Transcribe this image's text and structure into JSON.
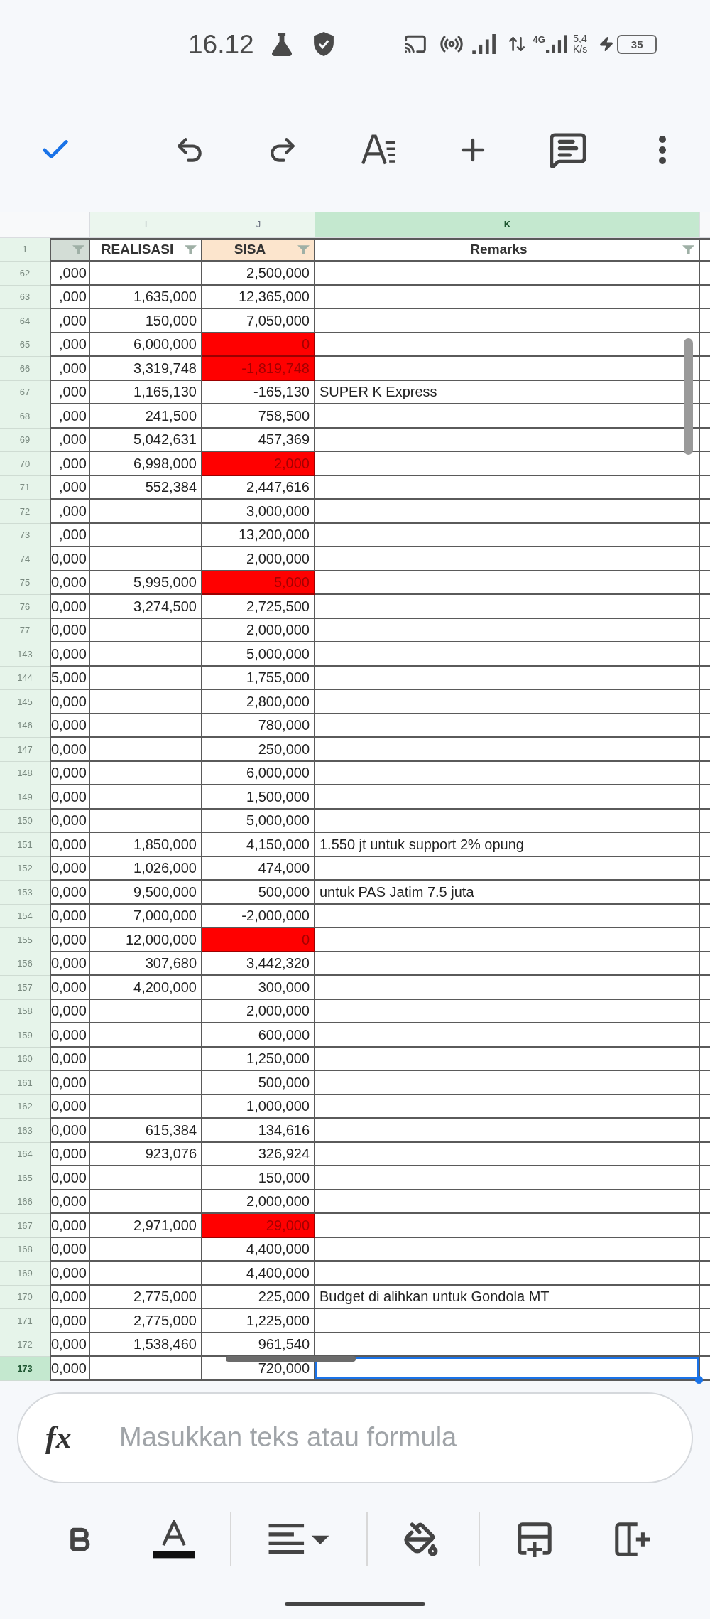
{
  "status_bar": {
    "time": "16.12",
    "network_type": "4G",
    "speed": "5,4",
    "speed_unit": "K/s",
    "battery": "35"
  },
  "sheet": {
    "columns": [
      {
        "letter": "I",
        "selected": false
      },
      {
        "letter": "J",
        "selected": false
      },
      {
        "letter": "K",
        "selected": true
      }
    ],
    "header_row": {
      "number": "1",
      "cells": [
        {
          "color": "#d3ddd6",
          "filter": true
        },
        {
          "title": "REALISASI",
          "color": "#ffffff",
          "filter": true
        },
        {
          "title": "SISA",
          "color": "#fce5cd",
          "filter": true
        },
        {
          "title": "Remarks",
          "color": "#ffffff",
          "filter": true
        }
      ]
    },
    "rows": [
      {
        "number": "62",
        "column_1": ",000",
        "sisa": "2,500,000",
        "flagged": false,
        "selected": false
      },
      {
        "number": "63",
        "column_1": ",000",
        "realisasi": "1,635,000",
        "sisa": "12,365,000",
        "flagged": false,
        "selected": false
      },
      {
        "number": "64",
        "column_1": ",000",
        "realisasi": "150,000",
        "sisa": "7,050,000",
        "flagged": false,
        "selected": false
      },
      {
        "number": "65",
        "column_1": ",000",
        "realisasi": "6,000,000",
        "sisa": "0",
        "flagged": true,
        "selected": false
      },
      {
        "number": "66",
        "column_1": ",000",
        "realisasi": "3,319,748",
        "sisa": "-1,819,748",
        "flagged": true,
        "selected": false
      },
      {
        "number": "67",
        "column_1": ",000",
        "realisasi": "1,165,130",
        "sisa": "-165,130",
        "remarks": "SUPER K Express",
        "flagged": false,
        "selected": false
      },
      {
        "number": "68",
        "column_1": ",000",
        "realisasi": "241,500",
        "sisa": "758,500",
        "flagged": false,
        "selected": false
      },
      {
        "number": "69",
        "column_1": ",000",
        "realisasi": "5,042,631",
        "sisa": "457,369",
        "flagged": false,
        "selected": false
      },
      {
        "number": "70",
        "column_1": ",000",
        "realisasi": "6,998,000",
        "sisa": "2,000",
        "flagged": true,
        "selected": false
      },
      {
        "number": "71",
        "column_1": ",000",
        "realisasi": "552,384",
        "sisa": "2,447,616",
        "flagged": false,
        "selected": false
      },
      {
        "number": "72",
        "column_1": ",000",
        "sisa": "3,000,000",
        "flagged": false,
        "selected": false
      },
      {
        "number": "73",
        "column_1": ",000",
        "sisa": "13,200,000",
        "flagged": false,
        "selected": false
      },
      {
        "number": "74",
        "column_1": "0,000",
        "sisa": "2,000,000",
        "flagged": false,
        "selected": false
      },
      {
        "number": "75",
        "column_1": "0,000",
        "realisasi": "5,995,000",
        "sisa": "5,000",
        "flagged": true,
        "selected": false
      },
      {
        "number": "76",
        "column_1": "0,000",
        "realisasi": "3,274,500",
        "sisa": "2,725,500",
        "flagged": false,
        "selected": false
      },
      {
        "number": "77",
        "column_1": "0,000",
        "sisa": "2,000,000",
        "flagged": false,
        "selected": false
      },
      {
        "number": "143",
        "column_1": "0,000",
        "sisa": "5,000,000",
        "flagged": false,
        "selected": false
      },
      {
        "number": "144",
        "column_1": "5,000",
        "sisa": "1,755,000",
        "flagged": false,
        "selected": false
      },
      {
        "number": "145",
        "column_1": "0,000",
        "sisa": "2,800,000",
        "flagged": false,
        "selected": false
      },
      {
        "number": "146",
        "column_1": "0,000",
        "sisa": "780,000",
        "flagged": false,
        "selected": false
      },
      {
        "number": "147",
        "column_1": "0,000",
        "sisa": "250,000",
        "flagged": false,
        "selected": false
      },
      {
        "number": "148",
        "column_1": "0,000",
        "sisa": "6,000,000",
        "flagged": false,
        "selected": false
      },
      {
        "number": "149",
        "column_1": "0,000",
        "sisa": "1,500,000",
        "flagged": false,
        "selected": false
      },
      {
        "number": "150",
        "column_1": "0,000",
        "sisa": "5,000,000",
        "flagged": false,
        "selected": false
      },
      {
        "number": "151",
        "column_1": "0,000",
        "realisasi": "1,850,000",
        "sisa": "4,150,000",
        "remarks": "1.550 jt untuk support 2% opung",
        "flagged": false,
        "selected": false
      },
      {
        "number": "152",
        "column_1": "0,000",
        "realisasi": "1,026,000",
        "sisa": "474,000",
        "flagged": false,
        "selected": false
      },
      {
        "number": "153",
        "column_1": "0,000",
        "realisasi": "9,500,000",
        "sisa": "500,000",
        "remarks": "untuk PAS Jatim 7.5 juta",
        "flagged": false,
        "selected": false
      },
      {
        "number": "154",
        "column_1": "0,000",
        "realisasi": "7,000,000",
        "sisa": "-2,000,000",
        "flagged": false,
        "selected": false
      },
      {
        "number": "155",
        "column_1": "0,000",
        "realisasi": "12,000,000",
        "sisa": "0",
        "flagged": true,
        "selected": false
      },
      {
        "number": "156",
        "column_1": "0,000",
        "realisasi": "307,680",
        "sisa": "3,442,320",
        "flagged": false,
        "selected": false
      },
      {
        "number": "157",
        "column_1": "0,000",
        "realisasi": "4,200,000",
        "sisa": "300,000",
        "flagged": false,
        "selected": false
      },
      {
        "number": "158",
        "column_1": "0,000",
        "sisa": "2,000,000",
        "flagged": false,
        "selected": false
      },
      {
        "number": "159",
        "column_1": "0,000",
        "sisa": "600,000",
        "flagged": false,
        "selected": false
      },
      {
        "number": "160",
        "column_1": "0,000",
        "sisa": "1,250,000",
        "flagged": false,
        "selected": false
      },
      {
        "number": "161",
        "column_1": "0,000",
        "sisa": "500,000",
        "flagged": false,
        "selected": false
      },
      {
        "number": "162",
        "column_1": "0,000",
        "sisa": "1,000,000",
        "flagged": false,
        "selected": false
      },
      {
        "number": "163",
        "column_1": "0,000",
        "realisasi": "615,384",
        "sisa": "134,616",
        "flagged": false,
        "selected": false
      },
      {
        "number": "164",
        "column_1": "0,000",
        "realisasi": "923,076",
        "sisa": "326,924",
        "flagged": false,
        "selected": false
      },
      {
        "number": "165",
        "column_1": "0,000",
        "sisa": "150,000",
        "flagged": false,
        "selected": false
      },
      {
        "number": "166",
        "column_1": "0,000",
        "sisa": "2,000,000",
        "flagged": false,
        "selected": false
      },
      {
        "number": "167",
        "column_1": "0,000",
        "realisasi": "2,971,000",
        "sisa": "29,000",
        "flagged": true,
        "selected": false
      },
      {
        "number": "168",
        "column_1": "0,000",
        "sisa": "4,400,000",
        "flagged": false,
        "selected": false
      },
      {
        "number": "169",
        "column_1": "0,000",
        "sisa": "4,400,000",
        "flagged": false,
        "selected": false
      },
      {
        "number": "170",
        "column_1": "0,000",
        "realisasi": "2,775,000",
        "sisa": "225,000",
        "remarks": "Budget di alihkan untuk Gondola MT",
        "flagged": false,
        "selected": false
      },
      {
        "number": "171",
        "column_1": "0,000",
        "realisasi": "2,775,000",
        "sisa": "1,225,000",
        "flagged": false,
        "selected": false
      },
      {
        "number": "172",
        "column_1": "0,000",
        "realisasi": "1,538,460",
        "sisa": "961,540",
        "flagged": false,
        "selected": false
      },
      {
        "number": "173",
        "column_1": "0,000",
        "sisa": "720,000",
        "flagged": false,
        "selected": true
      }
    ]
  },
  "formula_bar": {
    "symbol": "fx",
    "placeholder": "Masukkan teks atau formula"
  }
}
